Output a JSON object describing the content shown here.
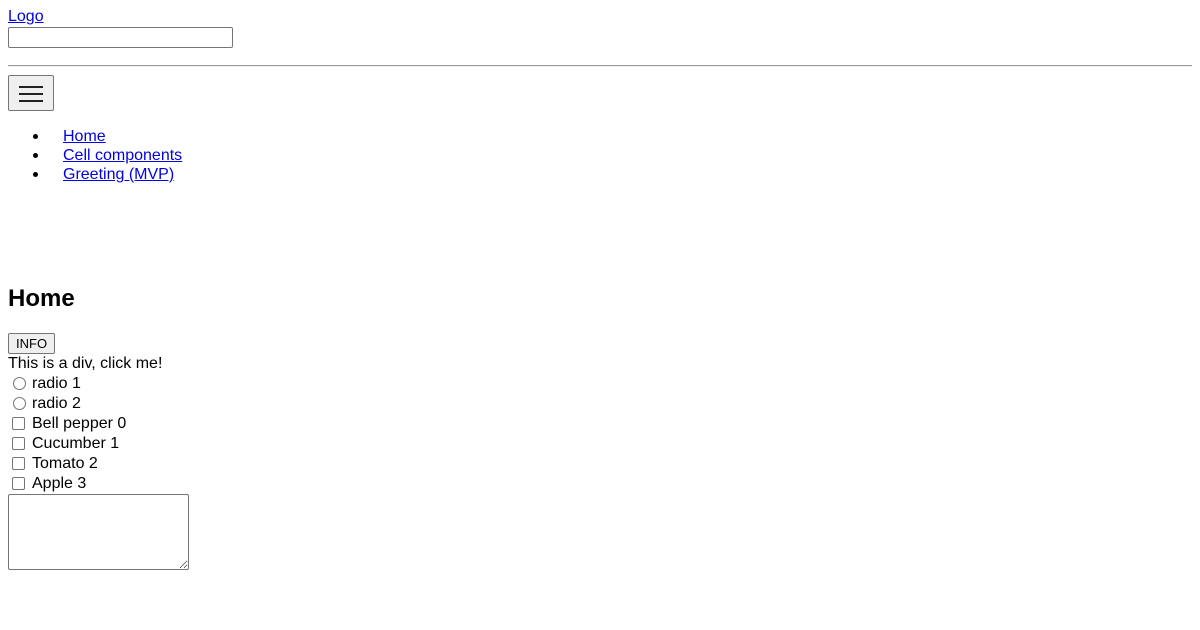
{
  "header": {
    "logo_text": "Logo",
    "search": {
      "value": "",
      "placeholder": ""
    }
  },
  "nav": {
    "menu_icon": "hamburger-menu-icon",
    "items": [
      {
        "label": "Home"
      },
      {
        "label": "Cell components"
      },
      {
        "label": "Greeting (MVP)"
      }
    ]
  },
  "main": {
    "title": "Home",
    "info_button_label": "INFO",
    "click_div_text": "This is a div, click me!",
    "radios": [
      {
        "label": "radio 1",
        "checked": false
      },
      {
        "label": "radio 2",
        "checked": false
      }
    ],
    "checkboxes": [
      {
        "label": "Bell pepper 0",
        "checked": false
      },
      {
        "label": "Cucumber 1",
        "checked": false
      },
      {
        "label": "Tomato 2",
        "checked": false
      },
      {
        "label": "Apple 3",
        "checked": false
      }
    ],
    "textarea": {
      "value": "",
      "placeholder": ""
    }
  }
}
